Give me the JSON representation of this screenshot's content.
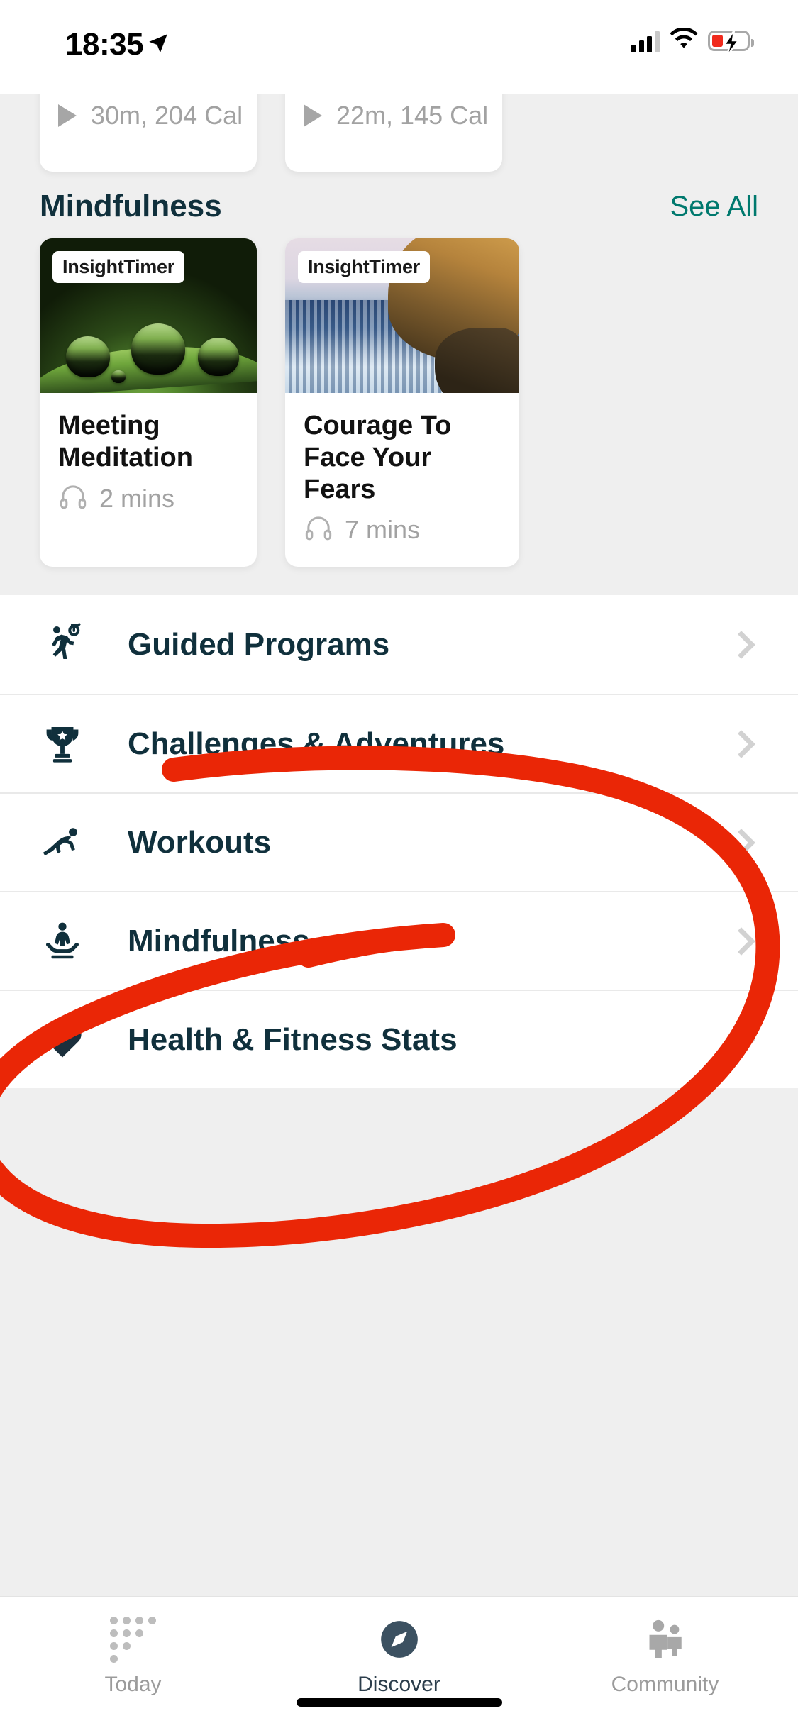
{
  "status_bar": {
    "time": "18:35",
    "location_icon": "location-arrow-icon",
    "cellular_icon": "cellular-bars-icon",
    "wifi_icon": "wifi-icon",
    "battery_icon": "battery-charging-low-icon"
  },
  "top_cards": [
    {
      "icon": "play-icon",
      "text": "30m, 204 Cal"
    },
    {
      "icon": "play-icon",
      "text": "22m, 145 Cal"
    }
  ],
  "mindfulness_section": {
    "title": "Mindfulness",
    "see_all": "See All",
    "cards": [
      {
        "badge": "InsightTimer",
        "title": "Meeting Meditation",
        "duration": "2 mins",
        "duration_icon": "headphones-icon",
        "image": "water-droplets-on-grass-blade"
      },
      {
        "badge": "InsightTimer",
        "title": "Courage To Face Your Fears",
        "duration": "7 mins",
        "duration_icon": "headphones-icon",
        "image": "ocean-cliff-coastline"
      }
    ]
  },
  "menu": {
    "items": [
      {
        "label": "Guided Programs",
        "icon": "running-person-timer-icon",
        "chevron": "chevron-right-icon"
      },
      {
        "label": "Challenges & Adventures",
        "icon": "trophy-icon",
        "chevron": "chevron-right-icon"
      },
      {
        "label": "Workouts",
        "icon": "sprinter-start-icon",
        "chevron": "chevron-right-icon"
      },
      {
        "label": "Mindfulness",
        "icon": "meditation-lotus-icon",
        "chevron": "chevron-right-icon"
      },
      {
        "label": "Health & Fitness Stats",
        "icon": "heart-icon",
        "chevron": "chevron-right-icon"
      }
    ]
  },
  "tab_bar": {
    "tabs": [
      {
        "label": "Today",
        "icon": "dots-grid-icon",
        "active": false
      },
      {
        "label": "Discover",
        "icon": "compass-icon",
        "active": true
      },
      {
        "label": "Community",
        "icon": "people-icon",
        "active": false
      }
    ]
  },
  "annotation": {
    "type": "hand-drawn-circle",
    "color": "#ea2606",
    "encircles": [
      "Mindfulness",
      "Health & Fitness Stats"
    ]
  },
  "colors": {
    "brand_navy": "#10303c",
    "teal_link": "#00796e",
    "page_bg": "#efefef",
    "muted_text": "#a2a2a2",
    "annotation_red": "#ea2606"
  }
}
